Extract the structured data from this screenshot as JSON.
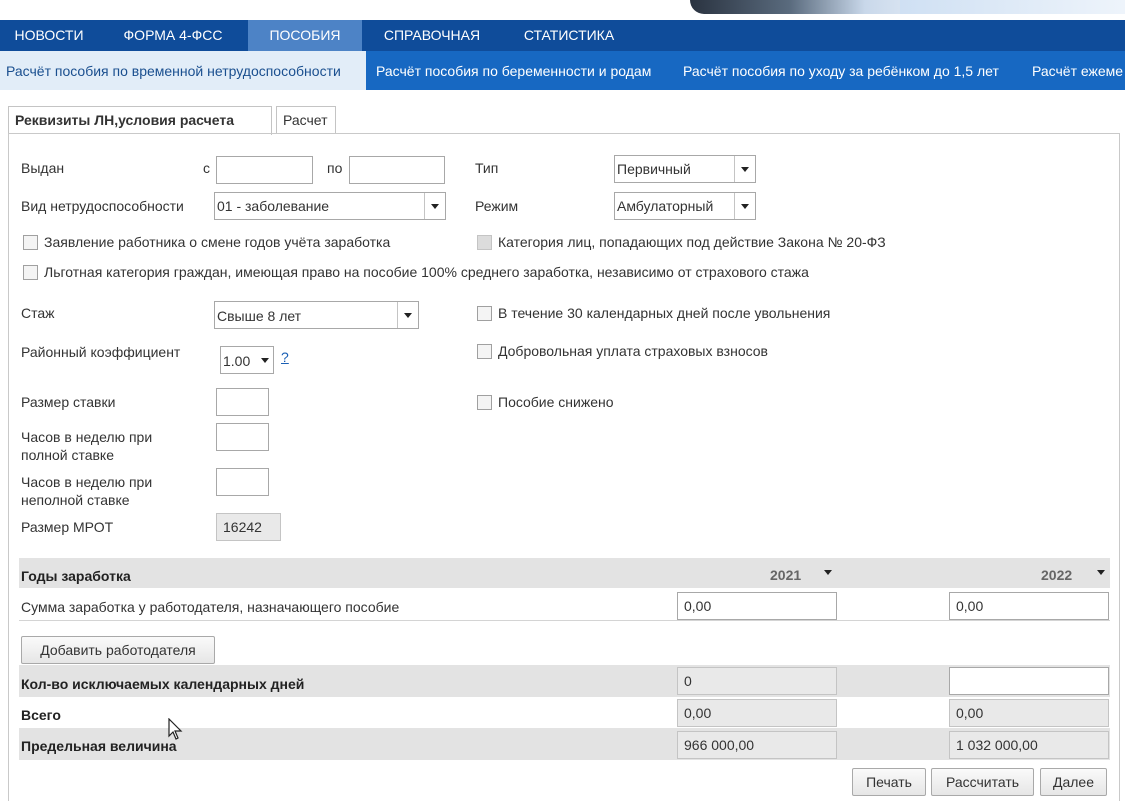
{
  "topnav": [
    "НОВОСТИ",
    "ФОРМА 4-ФСС",
    "ПОСОБИЯ",
    "СПРАВОЧНАЯ",
    "СТАТИСТИКА"
  ],
  "subnav": [
    "Расчёт пособия по временной нетрудоспособности",
    "Расчёт пособия по беременности и родам",
    "Расчёт пособия по уходу за ребёнком до 1,5 лет",
    "Расчёт ежеме"
  ],
  "tabs": [
    "Реквизиты ЛН,условия расчета",
    "Расчет"
  ],
  "form": {
    "issued_label": "Выдан",
    "from_label": "с",
    "to_label": "по",
    "type_label": "Тип",
    "type_value": "Первичный",
    "disability_label": "Вид нетрудоспособности",
    "disability_value": "01 - заболевание",
    "mode_label": "Режим",
    "mode_value": "Амбулаторный",
    "cb_years_change": "Заявление работника о смене годов учёта заработка",
    "cb_category_20fz": "Категория лиц, попадающих под действие Закона № 20-ФЗ",
    "cb_privileged": "Льготная категория граждан, имеющая право на пособие 100% среднего заработка, независимо от страхового стажа",
    "experience_label": "Стаж",
    "experience_value": "Свыше 8 лет",
    "cb_30days": "В течение 30 календарных дней после увольнения",
    "district_label": "Районный коэффициент",
    "district_value": "1.00",
    "help_label": "?",
    "cb_voluntary": "Добровольная уплата страховых взносов",
    "rate_label": "Размер ставки",
    "cb_reduced": "Пособие снижено",
    "hours_full_1": "Часов в неделю при",
    "hours_full_2": "полной ставке",
    "hours_part_1": "Часов в неделю при",
    "hours_part_2": "неполной ставке",
    "mrot_label": "Размер МРОТ",
    "mrot_value": "16242"
  },
  "earnings": {
    "years_label": "Годы заработка",
    "year1": "2021",
    "year2": "2022",
    "sum_label": "Сумма заработка у работодателя, назначающего пособие",
    "sum1": "0,00",
    "sum2": "0,00",
    "add_employer": "Добавить работодателя",
    "excluded_label": "Кол-во исключаемых календарных дней",
    "excluded1": "0",
    "excluded2": "",
    "total_label": "Всего",
    "total1": "0,00",
    "total2": "0,00",
    "limit_label": "Предельная величина",
    "limit1": "966 000,00",
    "limit2": "1 032 000,00"
  },
  "buttons": {
    "print": "Печать",
    "calculate": "Рассчитать",
    "next": "Далее"
  }
}
